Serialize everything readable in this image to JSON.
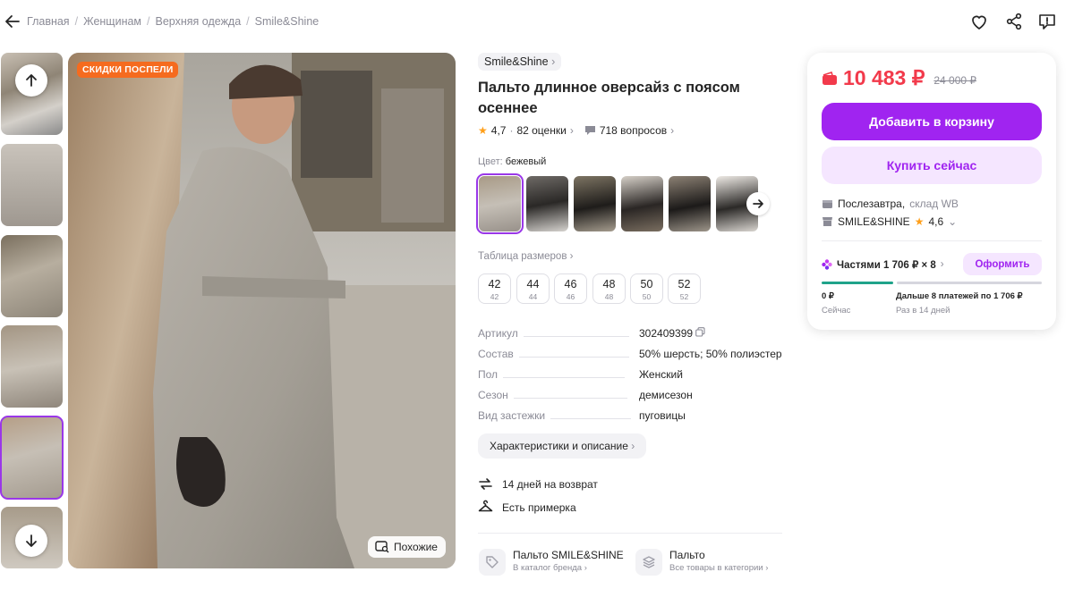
{
  "header": {
    "back_icon": "arrow-left-icon",
    "breadcrumbs": [
      "Главная",
      "Женщинам",
      "Верхняя одежда",
      "Smile&Shine"
    ],
    "separator": "/",
    "actions": [
      "heart-icon",
      "share-icon",
      "report-icon"
    ]
  },
  "gallery": {
    "badge": "СКИДКИ ПОСПЕЛИ",
    "similar_label": "Похожие",
    "selected_thumb_index": 4
  },
  "product": {
    "brand": "Smile&Shine",
    "title": "Пальто длинное оверсайз с поясом осеннее",
    "rating": "4,7",
    "reviews": "82 оценки",
    "questions": "718 вопросов",
    "color_label": "Цвет:",
    "color_value": "бежевый",
    "size_table_label": "Таблица размеров",
    "sizes": [
      {
        "ru": "42",
        "eu": "42"
      },
      {
        "ru": "44",
        "eu": "44"
      },
      {
        "ru": "46",
        "eu": "46"
      },
      {
        "ru": "48",
        "eu": "48"
      },
      {
        "ru": "50",
        "eu": "50"
      },
      {
        "ru": "52",
        "eu": "52"
      }
    ],
    "params": [
      {
        "key": "Артикул",
        "value": "302409399"
      },
      {
        "key": "Состав",
        "value": "50% шерсть; 50% полиэстер"
      },
      {
        "key": "Пол",
        "value": "Женский"
      },
      {
        "key": "Сезон",
        "value": "демисезон"
      },
      {
        "key": "Вид застежки",
        "value": "пуговицы"
      }
    ],
    "details_button": "Характеристики и описание",
    "features": [
      "14 дней на возврат",
      "Есть примерка"
    ],
    "brand_catalog": {
      "title": "Пальто SMILE&SHINE",
      "subtitle": "В каталог бренда"
    },
    "category": {
      "title": "Пальто",
      "subtitle": "Все товары в категории"
    }
  },
  "buy": {
    "price": "10 483 ₽",
    "old_price": "24 000 ₽",
    "add_to_cart": "Добавить в корзину",
    "buy_now": "Купить сейчас",
    "delivery": "Послезавтра,",
    "warehouse": "склад WB",
    "seller": "SMILE&SHINE",
    "seller_rating": "4,6",
    "installments": "Частями 1 706 ₽ × 8",
    "form_button": "Оформить",
    "plan_now_amount": "0 ₽",
    "plan_now_label": "Сейчас",
    "plan_next_amount": "Дальше 8 платежей по 1 706 ₽",
    "plan_next_label": "Раз в 14 дней"
  },
  "colors": {
    "accent": "#a024f0",
    "price_red": "#f23a4b",
    "badge_orange": "#f56b1f",
    "plan_green": "#1fa38a"
  }
}
